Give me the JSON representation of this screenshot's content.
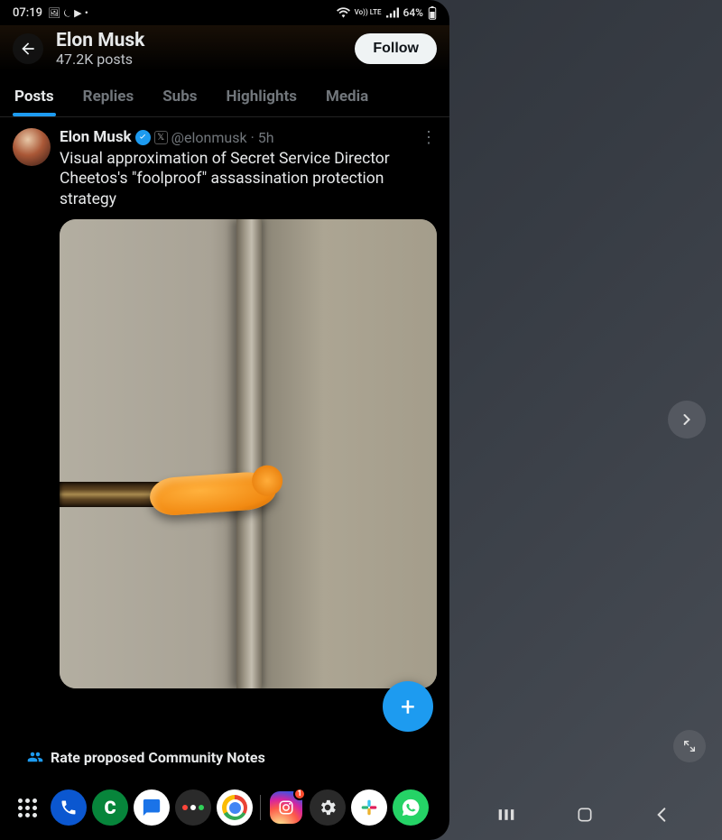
{
  "status": {
    "time": "07:19",
    "lte_label": "Vo)) LTE",
    "battery": "64%"
  },
  "header": {
    "name": "Elon Musk",
    "post_count": "47.2K posts",
    "follow_label": "Follow"
  },
  "tabs": [
    {
      "label": "Posts",
      "active": true
    },
    {
      "label": "Replies",
      "active": false
    },
    {
      "label": "Subs",
      "active": false
    },
    {
      "label": "Highlights",
      "active": false
    },
    {
      "label": "Media",
      "active": false
    }
  ],
  "post": {
    "author": "Elon Musk",
    "handle": "@elonmusk",
    "org_badge": "𝕏",
    "time": "5h",
    "sep": "·",
    "text": "Visual approximation of Secret Service Director Cheetos's \"foolproof\" assassination protection strategy"
  },
  "community_notes": {
    "label": "Rate proposed Community Notes"
  },
  "fab": {
    "label": "+"
  },
  "side_panel": {
    "chevron": "›"
  },
  "dock_notif": {
    "instagram": "1"
  }
}
